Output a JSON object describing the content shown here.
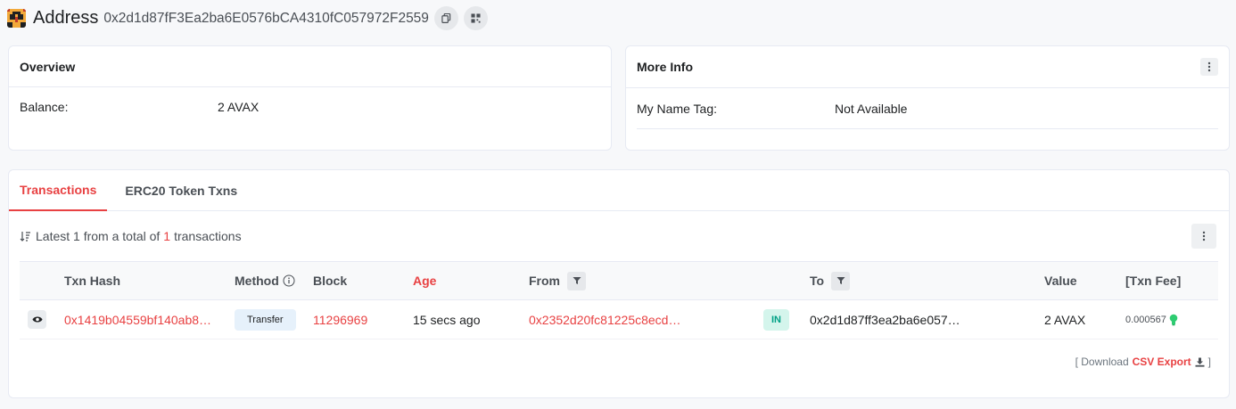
{
  "header": {
    "title": "Address",
    "address": "0x2d1d87fF3Ea2ba6E0576bCA4310fC057972F2559"
  },
  "overview": {
    "title": "Overview",
    "balance_label": "Balance:",
    "balance_value": "2 AVAX"
  },
  "more_info": {
    "title": "More Info",
    "name_tag_label": "My Name Tag:",
    "name_tag_value": "Not Available"
  },
  "tabs": [
    {
      "label": "Transactions",
      "active": true
    },
    {
      "label": "ERC20 Token Txns",
      "active": false
    }
  ],
  "summary": {
    "prefix": "Latest 1 from a total of",
    "count": "1",
    "suffix": "transactions"
  },
  "table": {
    "columns": {
      "txn_hash": "Txn Hash",
      "method": "Method",
      "block": "Block",
      "age": "Age",
      "from": "From",
      "to": "To",
      "value": "Value",
      "txn_fee": "[Txn Fee]"
    },
    "rows": [
      {
        "txn_hash": "0x1419b04559bf140ab8…",
        "method": "Transfer",
        "block": "11296969",
        "age": "15 secs ago",
        "from": "0x2352d20fc81225c8ecd…",
        "direction": "IN",
        "to": "0x2d1d87ff3ea2ba6e057…",
        "value": "2 AVAX",
        "txn_fee": "0.000567"
      }
    ]
  },
  "download": {
    "open": "[ Download",
    "csv": "CSV Export",
    "close": "]"
  },
  "colors": {
    "accent": "#e84142",
    "in_badge": "#00a186"
  },
  "icons": [
    "avatar",
    "copy-icon",
    "qr-code-icon",
    "kebab-icon",
    "sort-icon",
    "info-icon",
    "filter-icon",
    "eye-icon",
    "gas-bulb-icon",
    "download-icon"
  ]
}
